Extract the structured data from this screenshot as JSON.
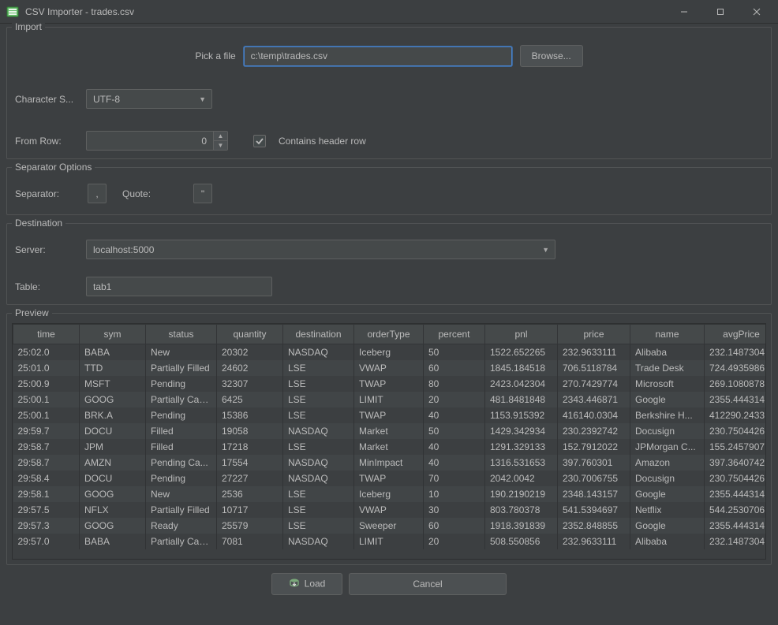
{
  "window": {
    "title": "CSV Importer - trades.csv"
  },
  "import": {
    "legend": "Import",
    "pick_label": "Pick a file",
    "file_value": "c:\\temp\\trades.csv",
    "browse_label": "Browse...",
    "charset_label": "Character S...",
    "charset_value": "UTF-8",
    "from_row_label": "From Row:",
    "from_row_value": "0",
    "header_checkbox_label": "Contains header row",
    "header_checked": true
  },
  "separator": {
    "legend": "Separator Options",
    "separator_label": "Separator:",
    "separator_value": ",",
    "quote_label": "Quote:",
    "quote_value": "\""
  },
  "destination": {
    "legend": "Destination",
    "server_label": "Server:",
    "server_value": "localhost:5000",
    "table_label": "Table:",
    "table_value": "tab1"
  },
  "preview": {
    "legend": "Preview",
    "columns": [
      "time",
      "sym",
      "status",
      "quantity",
      "destination",
      "orderType",
      "percent",
      "pnl",
      "price",
      "name",
      "avgPrice"
    ],
    "rows": [
      [
        "25:02.0",
        "BABA",
        "New",
        "20302",
        "NASDAQ",
        "Iceberg",
        "50",
        "1522.652265",
        "232.9633111",
        "Alibaba",
        "232.1487304"
      ],
      [
        "25:01.0",
        "TTD",
        "Partially Filled",
        "24602",
        "LSE",
        "VWAP",
        "60",
        "1845.184518",
        "706.5118784",
        "Trade Desk",
        "724.4935986"
      ],
      [
        "25:00.9",
        "MSFT",
        "Pending",
        "32307",
        "LSE",
        "TWAP",
        "80",
        "2423.042304",
        "270.7429774",
        "Microsoft",
        "269.1080878"
      ],
      [
        "25:00.1",
        "GOOG",
        "Partially Can...",
        "6425",
        "LSE",
        "LIMIT",
        "20",
        "481.8481848",
        "2343.446871",
        "Google",
        "2355.444314"
      ],
      [
        "25:00.1",
        "BRK.A",
        "Pending",
        "15386",
        "LSE",
        "TWAP",
        "40",
        "1153.915392",
        "416140.0304",
        "Berkshire H...",
        "412290.2433"
      ],
      [
        "29:59.7",
        "DOCU",
        "Filled",
        "19058",
        "NASDAQ",
        "Market",
        "50",
        "1429.342934",
        "230.2392742",
        "Docusign",
        "230.7504426"
      ],
      [
        "29:58.7",
        "JPM",
        "Filled",
        "17218",
        "LSE",
        "Market",
        "40",
        "1291.329133",
        "152.7912022",
        "JPMorgan C...",
        "155.2457907"
      ],
      [
        "29:58.7",
        "AMZN",
        "Pending Ca...",
        "17554",
        "NASDAQ",
        "MinImpact",
        "40",
        "1316.531653",
        "397.760301",
        "Amazon",
        "397.3640742"
      ],
      [
        "29:58.4",
        "DOCU",
        "Pending",
        "27227",
        "NASDAQ",
        "TWAP",
        "70",
        "2042.0042",
        "230.7006755",
        "Docusign",
        "230.7504426"
      ],
      [
        "29:58.1",
        "GOOG",
        "New",
        "2536",
        "LSE",
        "Iceberg",
        "10",
        "190.2190219",
        "2348.143157",
        "Google",
        "2355.444314"
      ],
      [
        "29:57.5",
        "NFLX",
        "Partially Filled",
        "10717",
        "LSE",
        "VWAP",
        "30",
        "803.780378",
        "541.5394697",
        "Netflix",
        "544.2530706"
      ],
      [
        "29:57.3",
        "GOOG",
        "Ready",
        "25579",
        "LSE",
        "Sweeper",
        "60",
        "1918.391839",
        "2352.848855",
        "Google",
        "2355.444314"
      ],
      [
        "29:57.0",
        "BABA",
        "Partially Can...",
        "7081",
        "NASDAQ",
        "LIMIT",
        "20",
        "508.550856",
        "232.9633111",
        "Alibaba",
        "232.1487304"
      ]
    ]
  },
  "actions": {
    "load_label": "Load",
    "cancel_label": "Cancel"
  }
}
